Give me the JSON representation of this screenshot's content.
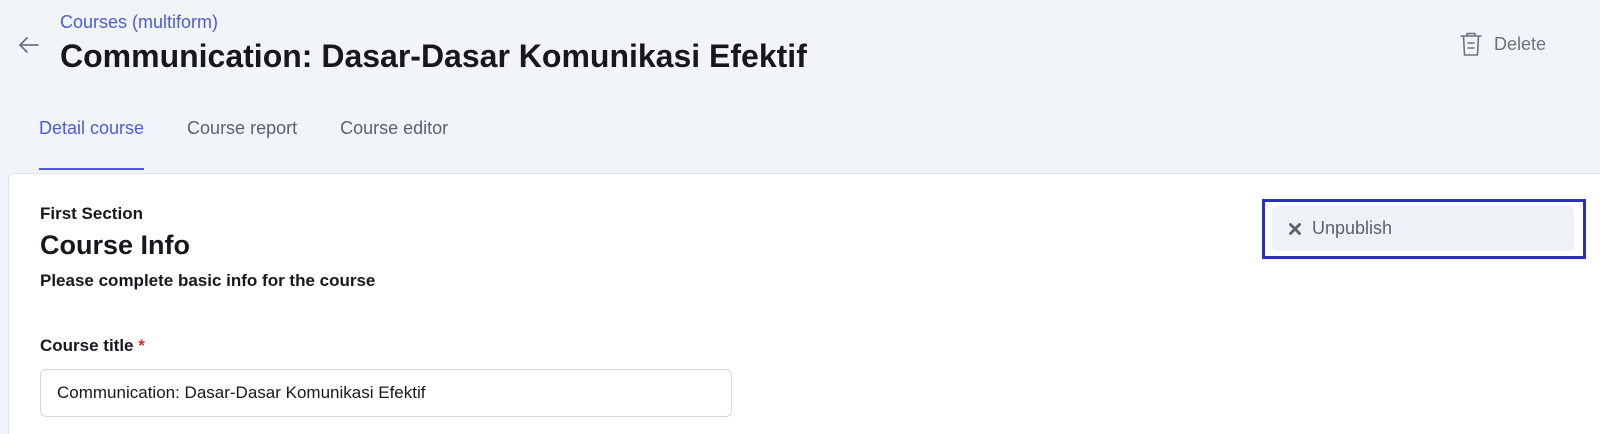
{
  "header": {
    "breadcrumb": "Courses (multiform)",
    "title": "Communication: Dasar-Dasar Komunikasi Efektif",
    "delete_label": "Delete"
  },
  "tabs": [
    {
      "label": "Detail course",
      "active": true
    },
    {
      "label": "Course report",
      "active": false
    },
    {
      "label": "Course editor",
      "active": false
    }
  ],
  "section": {
    "label": "First Section",
    "title": "Course Info",
    "description": "Please complete basic info for the course"
  },
  "form": {
    "course_title_label": "Course title",
    "required_mark": "*",
    "course_title_value": "Communication: Dasar-Dasar Komunikasi Efektif"
  },
  "actions": {
    "unpublish_label": "Unpublish"
  },
  "icons": {
    "back": "arrow-left-icon",
    "delete": "trash-icon",
    "unpublish": "close-icon"
  },
  "colors": {
    "accent": "#4f5bd5",
    "highlight": "#2a2fc4",
    "background": "#f1f4f9",
    "required": "#d92d20"
  }
}
